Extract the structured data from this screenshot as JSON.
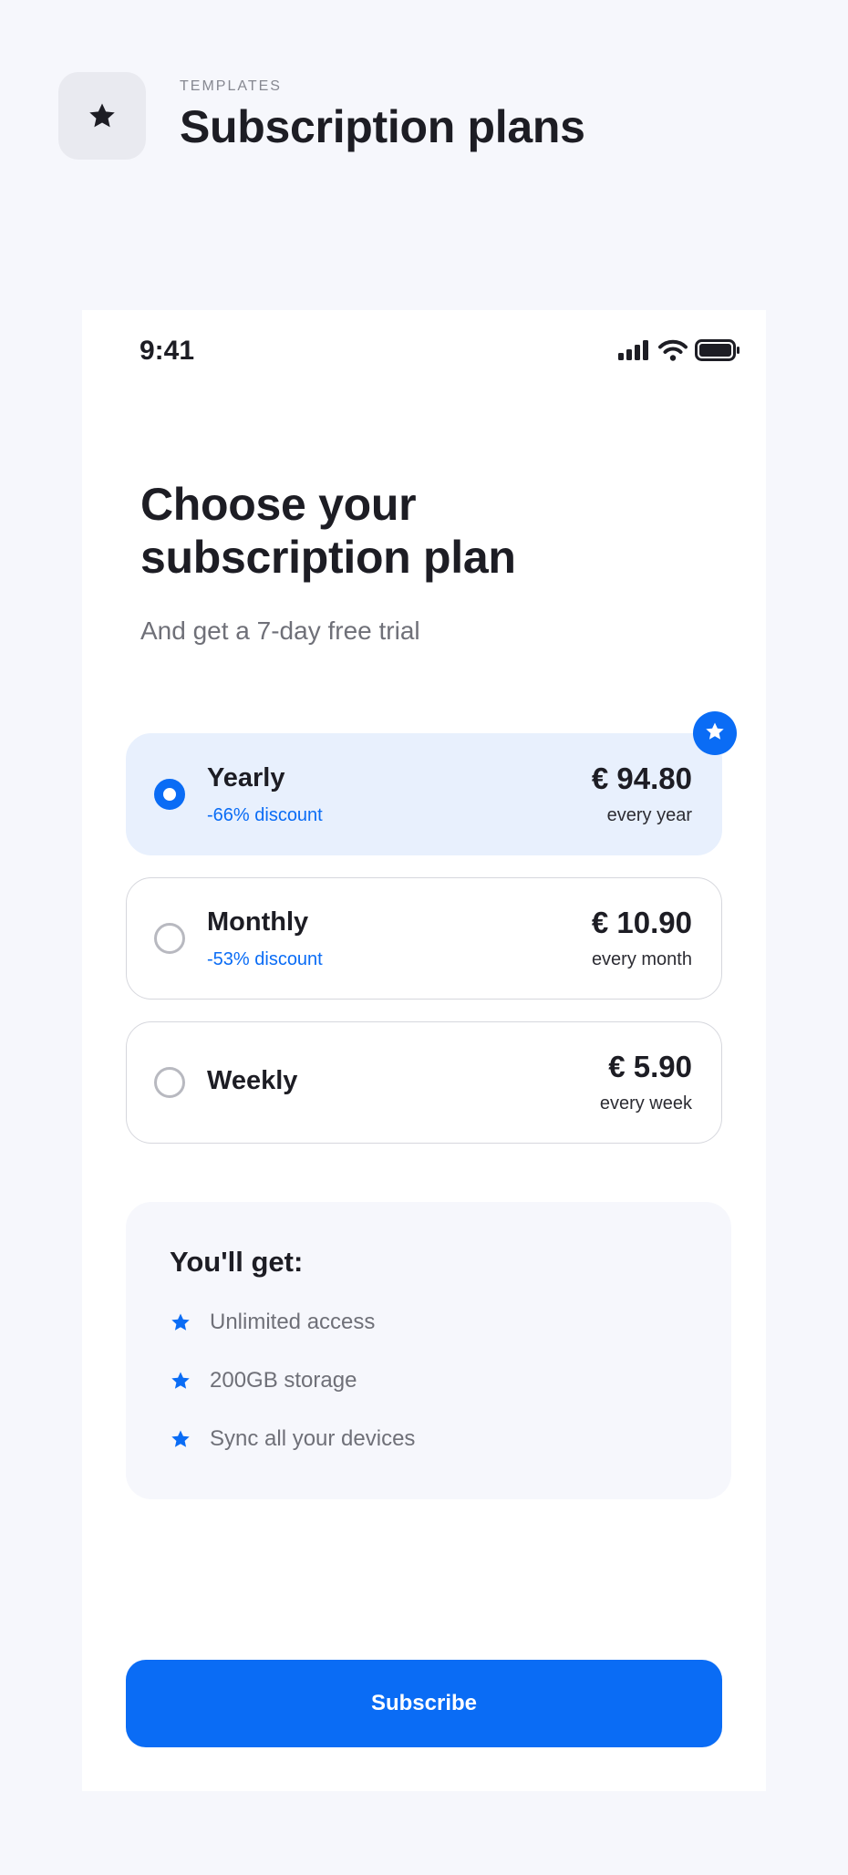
{
  "header": {
    "eyebrow": "TEMPLATES",
    "title": "Subscription plans",
    "icon": "star-icon"
  },
  "status_bar": {
    "time": "9:41",
    "icons": [
      "signal-icon",
      "wifi-icon",
      "battery-icon"
    ]
  },
  "screen": {
    "headline": "Choose your subscription plan",
    "subtitle": "And get a 7-day free trial"
  },
  "plans": [
    {
      "name": "Yearly",
      "discount": "-66% discount",
      "price": "€ 94.80",
      "period": "every year",
      "selected": true
    },
    {
      "name": "Monthly",
      "discount": "-53% discount",
      "price": "€ 10.90",
      "period": "every month",
      "selected": false
    },
    {
      "name": "Weekly",
      "discount": "",
      "price": "€ 5.90",
      "period": "every week",
      "selected": false
    }
  ],
  "benefits": {
    "title": "You'll get:",
    "items": [
      "Unlimited access",
      "200GB storage",
      "Sync all your devices"
    ]
  },
  "cta": {
    "label": "Subscribe"
  },
  "colors": {
    "accent": "#0a6cf5",
    "selected_bg": "#e8f0fd",
    "page_bg": "#f6f7fc",
    "text": "#1d1d24",
    "muted": "#6f7078"
  }
}
